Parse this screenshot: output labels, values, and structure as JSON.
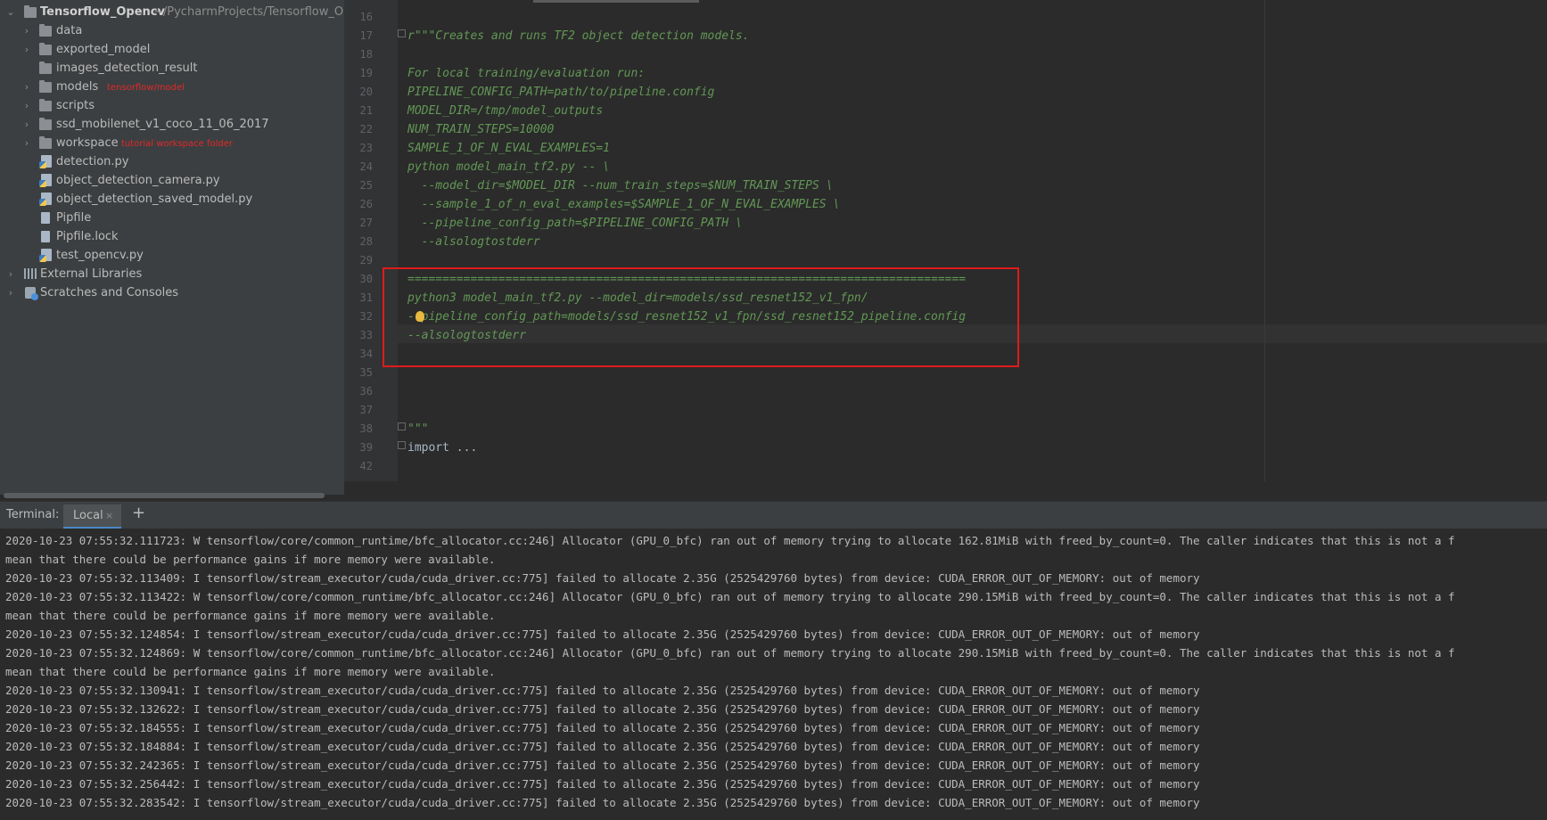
{
  "project": {
    "root": {
      "name": "Tensorflow_Opencv",
      "path": "~/PycharmProjects/Tensorflow_Ope"
    },
    "items": [
      {
        "label": "data",
        "type": "folder",
        "expandable": true
      },
      {
        "label": "exported_model",
        "type": "folder",
        "expandable": true
      },
      {
        "label": "images_detection_result",
        "type": "folder",
        "expandable": false
      },
      {
        "label": "models",
        "type": "folder",
        "expandable": true,
        "annotation": "tensorflow/model"
      },
      {
        "label": "scripts",
        "type": "folder",
        "expandable": true
      },
      {
        "label": "ssd_mobilenet_v1_coco_11_06_2017",
        "type": "folder",
        "expandable": true
      },
      {
        "label": "workspace",
        "type": "folder",
        "expandable": true,
        "annotation": "tutorial workspace folder"
      },
      {
        "label": "detection.py",
        "type": "python"
      },
      {
        "label": "object_detection_camera.py",
        "type": "python"
      },
      {
        "label": "object_detection_saved_model.py",
        "type": "python"
      },
      {
        "label": "Pipfile",
        "type": "text"
      },
      {
        "label": "Pipfile.lock",
        "type": "text"
      },
      {
        "label": "test_opencv.py",
        "type": "python"
      }
    ],
    "external_libraries": "External Libraries",
    "scratches": "Scratches and Consoles"
  },
  "editor": {
    "lines": [
      {
        "n": "16",
        "text": ""
      },
      {
        "n": "17",
        "text": "r\"\"\"Creates and runs TF2 object detection models."
      },
      {
        "n": "18",
        "text": ""
      },
      {
        "n": "19",
        "text": "For local training/evaluation run:"
      },
      {
        "n": "20",
        "text": "PIPELINE_CONFIG_PATH=path/to/pipeline.config"
      },
      {
        "n": "21",
        "text": "MODEL_DIR=/tmp/model_outputs"
      },
      {
        "n": "22",
        "text": "NUM_TRAIN_STEPS=10000"
      },
      {
        "n": "23",
        "text": "SAMPLE_1_OF_N_EVAL_EXAMPLES=1"
      },
      {
        "n": "24",
        "text": "python model_main_tf2.py -- \\"
      },
      {
        "n": "25",
        "text": "  --model_dir=$MODEL_DIR --num_train_steps=$NUM_TRAIN_STEPS \\"
      },
      {
        "n": "26",
        "text": "  --sample_1_of_n_eval_examples=$SAMPLE_1_OF_N_EVAL_EXAMPLES \\"
      },
      {
        "n": "27",
        "text": "  --pipeline_config_path=$PIPELINE_CONFIG_PATH \\"
      },
      {
        "n": "28",
        "text": "  --alsologtostderr"
      },
      {
        "n": "29",
        "text": ""
      },
      {
        "n": "30",
        "text": "================================================================================"
      },
      {
        "n": "31",
        "text": "python3 model_main_tf2.py --model_dir=models/ssd_resnet152_v1_fpn/"
      },
      {
        "n": "32",
        "text": "--pipeline_config_path=models/ssd_resnet152_v1_fpn/ssd_resnet152_pipeline.config"
      },
      {
        "n": "33",
        "text": "--alsologtostderr"
      },
      {
        "n": "34",
        "text": ""
      },
      {
        "n": "35",
        "text": ""
      },
      {
        "n": "36",
        "text": ""
      },
      {
        "n": "37",
        "text": ""
      },
      {
        "n": "38",
        "text": "\"\"\""
      },
      {
        "n": "39",
        "text": "import ..."
      },
      {
        "n": "42",
        "text": ""
      }
    ]
  },
  "terminal": {
    "title": "Terminal:",
    "tab": "Local",
    "lines": [
      "2020-10-23 07:55:32.111723: W tensorflow/core/common_runtime/bfc_allocator.cc:246] Allocator (GPU_0_bfc) ran out of memory trying to allocate 162.81MiB with freed_by_count=0. The caller indicates that this is not a f",
      "mean that there could be performance gains if more memory were available.",
      "2020-10-23 07:55:32.113409: I tensorflow/stream_executor/cuda/cuda_driver.cc:775] failed to allocate 2.35G (2525429760 bytes) from device: CUDA_ERROR_OUT_OF_MEMORY: out of memory",
      "2020-10-23 07:55:32.113422: W tensorflow/core/common_runtime/bfc_allocator.cc:246] Allocator (GPU_0_bfc) ran out of memory trying to allocate 290.15MiB with freed_by_count=0. The caller indicates that this is not a f",
      "mean that there could be performance gains if more memory were available.",
      "2020-10-23 07:55:32.124854: I tensorflow/stream_executor/cuda/cuda_driver.cc:775] failed to allocate 2.35G (2525429760 bytes) from device: CUDA_ERROR_OUT_OF_MEMORY: out of memory",
      "2020-10-23 07:55:32.124869: W tensorflow/core/common_runtime/bfc_allocator.cc:246] Allocator (GPU_0_bfc) ran out of memory trying to allocate 290.15MiB with freed_by_count=0. The caller indicates that this is not a f",
      "mean that there could be performance gains if more memory were available.",
      "2020-10-23 07:55:32.130941: I tensorflow/stream_executor/cuda/cuda_driver.cc:775] failed to allocate 2.35G (2525429760 bytes) from device: CUDA_ERROR_OUT_OF_MEMORY: out of memory",
      "2020-10-23 07:55:32.132622: I tensorflow/stream_executor/cuda/cuda_driver.cc:775] failed to allocate 2.35G (2525429760 bytes) from device: CUDA_ERROR_OUT_OF_MEMORY: out of memory",
      "2020-10-23 07:55:32.184555: I tensorflow/stream_executor/cuda/cuda_driver.cc:775] failed to allocate 2.35G (2525429760 bytes) from device: CUDA_ERROR_OUT_OF_MEMORY: out of memory",
      "2020-10-23 07:55:32.184884: I tensorflow/stream_executor/cuda/cuda_driver.cc:775] failed to allocate 2.35G (2525429760 bytes) from device: CUDA_ERROR_OUT_OF_MEMORY: out of memory",
      "2020-10-23 07:55:32.242365: I tensorflow/stream_executor/cuda/cuda_driver.cc:775] failed to allocate 2.35G (2525429760 bytes) from device: CUDA_ERROR_OUT_OF_MEMORY: out of memory",
      "2020-10-23 07:55:32.256442: I tensorflow/stream_executor/cuda/cuda_driver.cc:775] failed to allocate 2.35G (2525429760 bytes) from device: CUDA_ERROR_OUT_OF_MEMORY: out of memory",
      "2020-10-23 07:55:32.283542: I tensorflow/stream_executor/cuda/cuda_driver.cc:775] failed to allocate 2.35G (2525429760 bytes) from device: CUDA_ERROR_OUT_OF_MEMORY: out of memory"
    ]
  },
  "icons": {
    "chevron-right": "›",
    "chevron-down": "⌄",
    "close": "×",
    "add": "+"
  },
  "colors": {
    "annotation": "#e22828",
    "highlight_box": "#e01b1b",
    "docstring": "#629755",
    "tab_accent": "#4a88c7"
  }
}
